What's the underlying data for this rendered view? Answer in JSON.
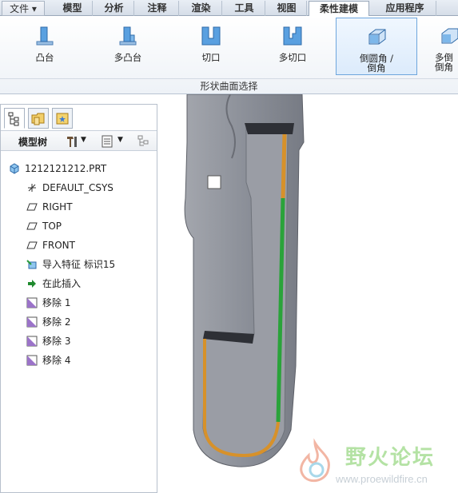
{
  "menu": {
    "tabs": [
      {
        "label": "文件 ▾"
      },
      {
        "label": "模型"
      },
      {
        "label": "分析"
      },
      {
        "label": "注释"
      },
      {
        "label": "渲染"
      },
      {
        "label": "工具"
      },
      {
        "label": "视图"
      },
      {
        "label": "柔性建模"
      },
      {
        "label": "应用程序"
      }
    ],
    "active_tab": "柔性建模"
  },
  "ribbon": {
    "tools": [
      {
        "label": "凸台",
        "icon": "boss-icon"
      },
      {
        "label": "多凸台",
        "icon": "multi-boss-icon"
      },
      {
        "label": "切口",
        "icon": "cut-icon"
      },
      {
        "label": "多切口",
        "icon": "multi-cut-icon"
      },
      {
        "label": "倒圆角 /\n倒角",
        "icon": "round-chamfer-icon"
      },
      {
        "label": "多倒\n倒角",
        "icon": "multi-round-icon"
      }
    ],
    "group_label": "形状曲面选择"
  },
  "panel": {
    "title": "模型树",
    "tree": [
      {
        "label": "1212121212.PRT",
        "icon": "part-icon"
      },
      {
        "label": "DEFAULT_CSYS",
        "icon": "csys-icon"
      },
      {
        "label": "RIGHT",
        "icon": "datum-plane-icon"
      },
      {
        "label": "TOP",
        "icon": "datum-plane-icon"
      },
      {
        "label": "FRONT",
        "icon": "datum-plane-icon"
      },
      {
        "label": "导入特征 标识15",
        "icon": "import-feature-icon"
      },
      {
        "label": "在此插入",
        "icon": "insert-here-arrow-icon"
      },
      {
        "label": "移除 1",
        "icon": "remove-feature-icon"
      },
      {
        "label": "移除 2",
        "icon": "remove-feature-icon"
      },
      {
        "label": "移除 3",
        "icon": "remove-feature-icon"
      },
      {
        "label": "移除 4",
        "icon": "remove-feature-icon"
      }
    ]
  },
  "watermark": {
    "title": "野火论坛",
    "url": "www.proewildfire.cn"
  },
  "colors": {
    "model_body": "#8a8d96",
    "edge_highlight_orange": "#d7912a",
    "edge_highlight_green": "#2aa33a",
    "ribbon_selected": "#6ea6dd"
  }
}
